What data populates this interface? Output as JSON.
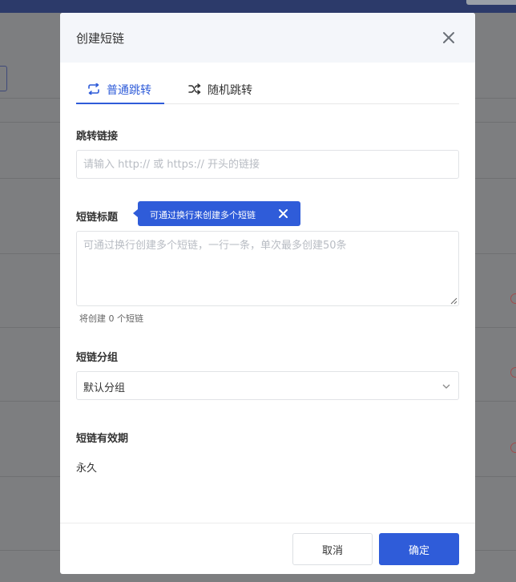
{
  "modal": {
    "title": "创建短链",
    "tabs": [
      {
        "label": "普通跳转",
        "icon": "repeat-icon",
        "active": true
      },
      {
        "label": "随机跳转",
        "icon": "shuffle-icon",
        "active": false
      }
    ],
    "link_field": {
      "label": "跳转链接",
      "placeholder": "请输入 http:// 或 https:// 开头的链接",
      "value": ""
    },
    "title_field": {
      "label": "短链标题",
      "placeholder": "可通过换行创建多个短链，一行一条，单次最多创建50条",
      "value": "",
      "hint": "将创建 0 个短链"
    },
    "tooltip": {
      "text": "可通过换行来创建多个短链"
    },
    "group_field": {
      "label": "短链分组",
      "selected": "默认分组"
    },
    "expire_field": {
      "label": "短链有效期",
      "value": "永久"
    },
    "buttons": {
      "cancel": "取消",
      "ok": "确定"
    },
    "accent_color": "#2f5cd9"
  }
}
